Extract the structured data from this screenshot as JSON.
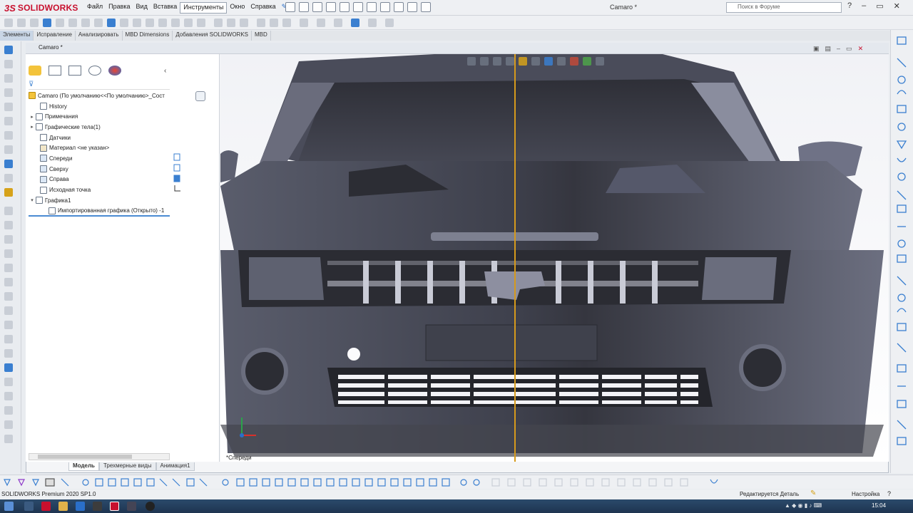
{
  "app": {
    "brand_ds": "3S",
    "brand_name": "SOLIDWORKS",
    "document_title": "Camaro *"
  },
  "menu": [
    "Файл",
    "Правка",
    "Вид",
    "Вставка",
    "Инструменты",
    "Окно",
    "Справка"
  ],
  "menu_active": "Инструменты",
  "search": {
    "placeholder": "Поиск в Форуме"
  },
  "command_tabs": [
    "Элементы",
    "Исправление",
    "Анализировать",
    "MBD Dimensions",
    "Добавления SOLIDWORKS",
    "MBD"
  ],
  "command_tab_active": "Элементы",
  "document_tab": "Camaro *",
  "tree": {
    "root": "Camaro  (По умолчанию<<По умолчанию>_Сост",
    "items": [
      {
        "label": "History",
        "expander": ""
      },
      {
        "label": "Примечания",
        "expander": "▸"
      },
      {
        "label": "Графические тела(1)",
        "expander": "▸"
      },
      {
        "label": "Датчики",
        "expander": ""
      },
      {
        "label": "Материал <не указан>",
        "expander": ""
      },
      {
        "label": "Спереди",
        "expander": ""
      },
      {
        "label": "Сверху",
        "expander": ""
      },
      {
        "label": "Справа",
        "expander": ""
      },
      {
        "label": "Исходная точка",
        "expander": ""
      },
      {
        "label": "Графика1",
        "expander": "▾"
      },
      {
        "label": "Импортированная графика (Открыто) -1",
        "expander": "",
        "indent": true
      }
    ]
  },
  "bottom_tabs": [
    "Модель",
    "Трехмерные виды",
    "Анимация1"
  ],
  "bottom_tab_active": "Модель",
  "viewport": {
    "view_label": "*Спереди"
  },
  "status": {
    "left": "SOLIDWORKS Premium 2020 SP1.0",
    "editing": "Редактируется Деталь",
    "units": "Настройка"
  },
  "taskbar": {
    "clock": "15:04"
  },
  "colors": {
    "brand_red": "#c8102e",
    "selection_blue": "#4a8ad3",
    "section_line": "#d69a1c",
    "car_body": "#4a4d5c"
  }
}
